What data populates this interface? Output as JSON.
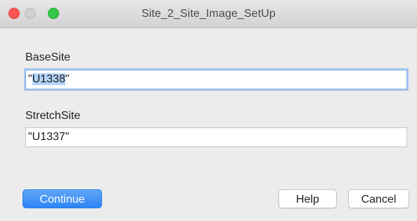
{
  "window": {
    "title": "Site_2_Site_Image_SetUp"
  },
  "form": {
    "base_site": {
      "label": "BaseSite",
      "value_prefix": "\"",
      "value_selected": "U1338",
      "value_suffix": "\""
    },
    "stretch_site": {
      "label": "StretchSite",
      "value": "\"U1337\""
    }
  },
  "buttons": {
    "continue_label": "Continue",
    "help_label": "Help",
    "cancel_label": "Cancel"
  },
  "colors": {
    "accent": "#2c84f4",
    "close_light": "#fc5753",
    "maximize_light": "#33c748",
    "selection": "#b4d4fb"
  }
}
